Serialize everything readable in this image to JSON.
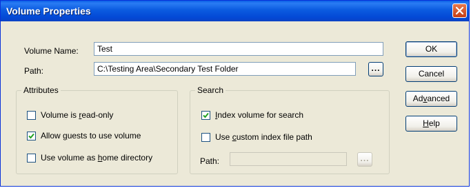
{
  "window": {
    "title": "Volume Properties"
  },
  "form": {
    "volume_name_label": "Volume Name:",
    "volume_name_value": "Test",
    "path_label": "Path:",
    "path_value": "C:\\Testing Area\\Secondary Test Folder",
    "browse_label": "..."
  },
  "buttons": {
    "ok": "OK",
    "cancel": "Cancel",
    "advanced": "Advanced",
    "help": "Help"
  },
  "attributes": {
    "title": "Attributes",
    "options": [
      {
        "label": "Volume is read-only",
        "checked": false
      },
      {
        "label": "Allow guests to use volume",
        "checked": true
      },
      {
        "label": "Use volume as home directory",
        "checked": false
      }
    ]
  },
  "search": {
    "title": "Search",
    "options": [
      {
        "label": "Index volume for search",
        "checked": true
      },
      {
        "label": "Use custom index file path",
        "checked": false
      }
    ],
    "path_label": "Path:",
    "path_value": "",
    "browse_label": "..."
  },
  "icons": {
    "close": "close-icon",
    "checkmark": "checkmark-icon"
  },
  "colors": {
    "titlebar": "#0a5fe6",
    "close": "#c63d14",
    "dialog": "#ece9d8"
  }
}
